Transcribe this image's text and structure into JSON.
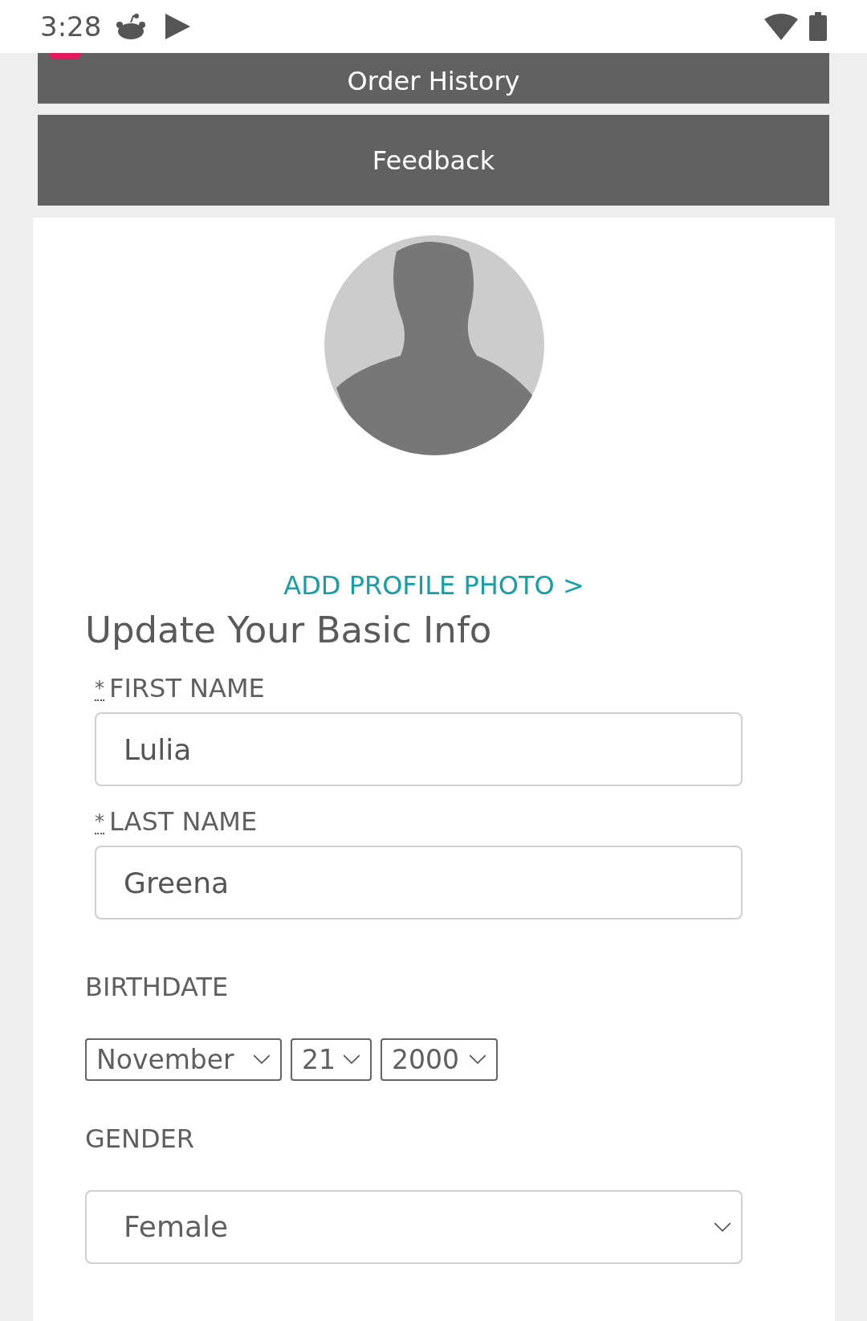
{
  "status_bar": {
    "time": "3:28"
  },
  "menu": [
    {
      "label": "Order History"
    },
    {
      "label": "Feedback"
    }
  ],
  "profile": {
    "add_photo_link": "ADD PROFILE PHOTO >",
    "heading": "Update Your Basic Info"
  },
  "fields": [
    {
      "required_mark": "*",
      "label": "FIRST NAME",
      "value": "Lulia"
    },
    {
      "required_mark": "*",
      "label": "LAST NAME",
      "value": "Greena"
    }
  ],
  "birthdate": {
    "label": "BIRTHDATE",
    "month": "November",
    "day": "21",
    "year": "2000"
  },
  "gender": {
    "label": "GENDER",
    "value": "Female"
  }
}
